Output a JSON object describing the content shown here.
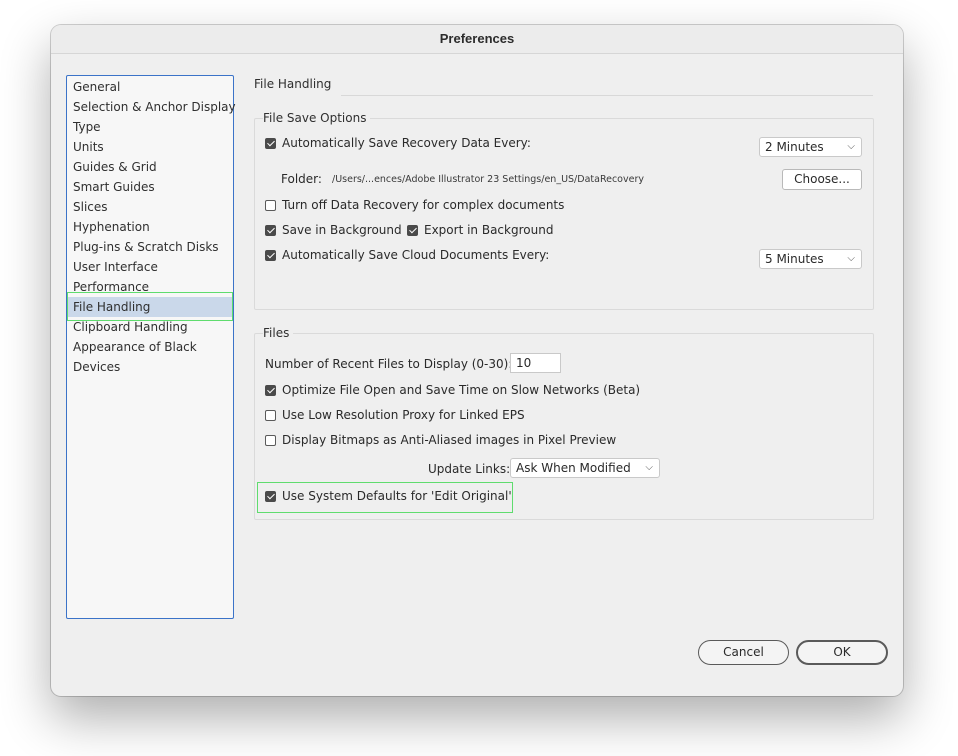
{
  "window": {
    "title": "Preferences"
  },
  "sidebar": {
    "items": [
      {
        "label": "General"
      },
      {
        "label": "Selection & Anchor Display"
      },
      {
        "label": "Type"
      },
      {
        "label": "Units"
      },
      {
        "label": "Guides & Grid"
      },
      {
        "label": "Smart Guides"
      },
      {
        "label": "Slices"
      },
      {
        "label": "Hyphenation"
      },
      {
        "label": "Plug-ins & Scratch Disks"
      },
      {
        "label": "User Interface"
      },
      {
        "label": "Performance"
      },
      {
        "label": "File Handling",
        "selected": true
      },
      {
        "label": "Clipboard Handling"
      },
      {
        "label": "Appearance of Black"
      },
      {
        "label": "Devices"
      }
    ]
  },
  "panel": {
    "title": "File Handling"
  },
  "save_options": {
    "legend": "File Save Options",
    "auto_save": {
      "label": "Automatically Save Recovery Data Every:",
      "checked": true,
      "interval": "2 Minutes"
    },
    "folder": {
      "label": "Folder:",
      "path": "/Users/...ences/Adobe Illustrator 23 Settings/en_US/DataRecovery",
      "button": "Choose..."
    },
    "turn_off_recovery": {
      "label": "Turn off Data Recovery for complex documents",
      "checked": false
    },
    "save_bg": {
      "label": "Save in Background",
      "checked": true
    },
    "export_bg": {
      "label": "Export in Background",
      "checked": true
    },
    "cloud_save": {
      "label": "Automatically Save Cloud Documents Every:",
      "checked": true,
      "interval": "5 Minutes"
    }
  },
  "files": {
    "legend": "Files",
    "recent": {
      "label": "Number of Recent Files to Display (0-30):",
      "value": "10"
    },
    "optimize": {
      "label": "Optimize File Open and Save Time on Slow Networks (Beta)",
      "checked": true
    },
    "low_res": {
      "label": "Use Low Resolution Proxy for Linked EPS",
      "checked": false
    },
    "bitmaps": {
      "label": "Display Bitmaps as Anti-Aliased images in Pixel Preview",
      "checked": false
    },
    "update_links": {
      "label": "Update Links:",
      "value": "Ask When Modified"
    },
    "edit_original": {
      "label": "Use System Defaults for 'Edit Original'",
      "checked": true
    }
  },
  "footer": {
    "cancel": "Cancel",
    "ok": "OK"
  },
  "colors": {
    "selection": "#cad8ea",
    "highlight": "#5fdc6e",
    "sidebar_border": "#3b73c8"
  }
}
